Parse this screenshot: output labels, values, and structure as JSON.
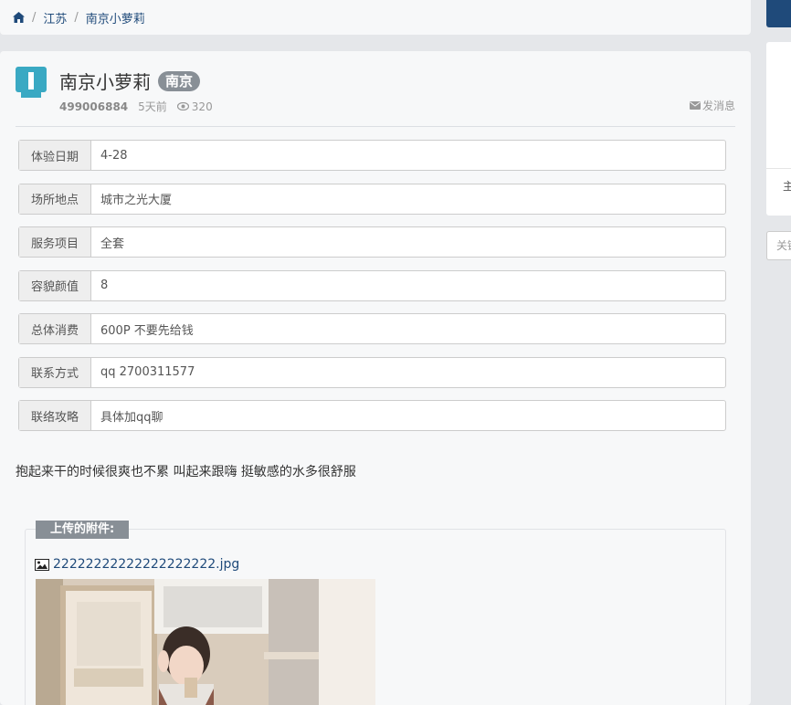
{
  "breadcrumb": {
    "home_icon": "home-icon",
    "sep1": "/",
    "region": "江苏",
    "sep2": "/",
    "current": "南京小萝莉"
  },
  "post": {
    "avatar_icon": "bookmark-avatar-icon",
    "title": "南京小萝莉",
    "city_badge": "南京",
    "uid": "499006884",
    "time": "5天前",
    "views": "320",
    "message_label": "发消息",
    "fields": [
      {
        "label": "体验日期",
        "value": "4-28"
      },
      {
        "label": "场所地点",
        "value": "城市之光大厦"
      },
      {
        "label": "服务项目",
        "value": "全套"
      },
      {
        "label": "容貌颜值",
        "value": "8"
      },
      {
        "label": "总体消费",
        "value": "600P 不要先给钱"
      },
      {
        "label": "联系方式",
        "value": "qq 2700311577"
      },
      {
        "label": "联络攻略",
        "value": "具体加qq聊"
      }
    ],
    "description": "抱起来干的时候很爽也不累 叫起来跟嗨 挺敏感的水多很舒服"
  },
  "attachments": {
    "legend": "上传的附件:",
    "file_name": "22222222222222222222.jpg",
    "file_icon": "image-icon"
  },
  "sidebar": {
    "card_text": "主",
    "search_placeholder": "关键"
  },
  "colors": {
    "accent": "#1f4a7a",
    "badge": "#888f96",
    "avatar": "#3aa9c3"
  }
}
